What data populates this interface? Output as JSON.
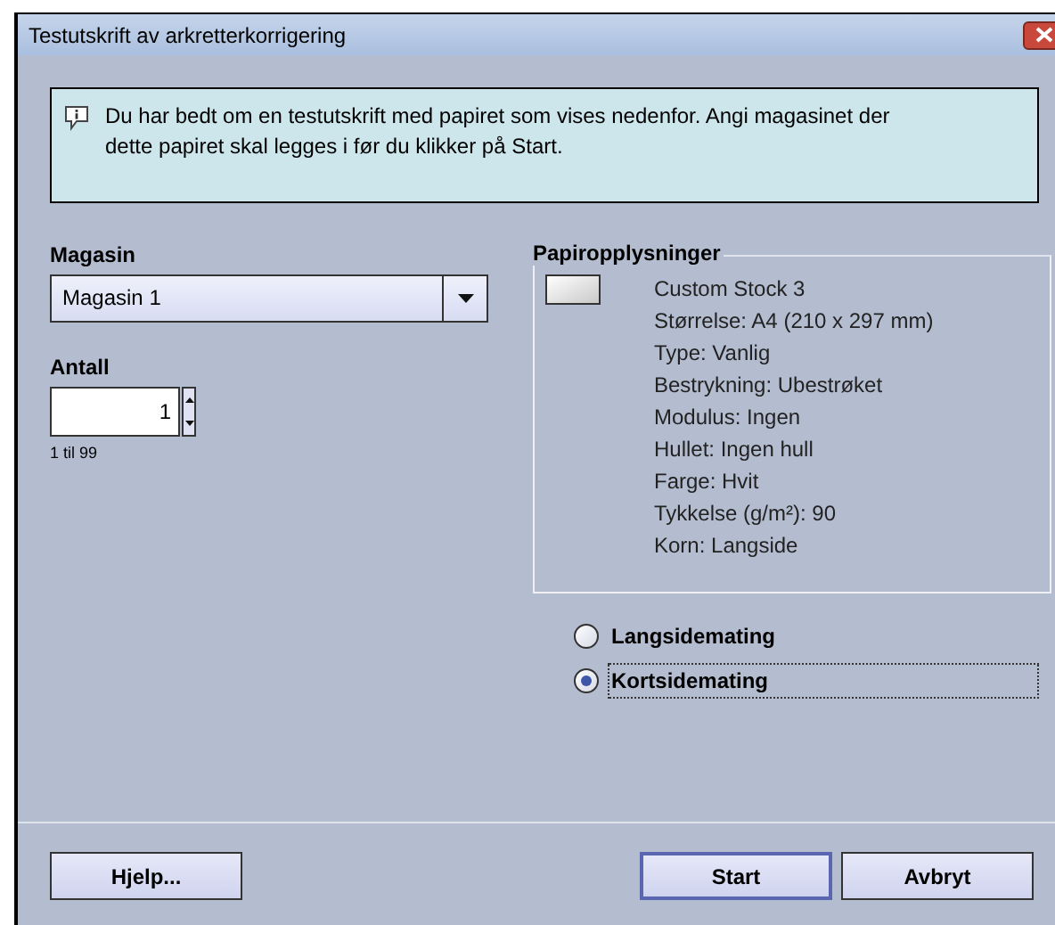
{
  "window": {
    "title": "Testutskrift av arkretterkorrigering"
  },
  "message": "Du har bedt om en testutskrift med papiret som vises nedenfor.  Angi magasinet der dette papiret skal legges i før du klikker på Start.",
  "tray": {
    "label": "Magasin",
    "value": "Magasin 1"
  },
  "quantity": {
    "label": "Antall",
    "value": "1",
    "range": "1 til 99"
  },
  "paper_info": {
    "title": "Papiropplysninger",
    "lines": [
      "Custom Stock 3",
      "Størrelse: A4 (210 x 297 mm)",
      "Type: Vanlig",
      "Bestrykning: Ubestrøket",
      "Modulus: Ingen",
      "Hullet: Ingen hull",
      "Farge: Hvit",
      "Tykkelse (g/m²): 90",
      "Korn: Langside"
    ]
  },
  "feed_options": [
    {
      "label": "Langsidemating",
      "selected": false
    },
    {
      "label": "Kortsidemating",
      "selected": true
    }
  ],
  "buttons": [
    {
      "label": "Hjelp...",
      "kind": "left"
    },
    {
      "label": "Start",
      "kind": "default"
    },
    {
      "label": "Avbryt",
      "kind": "right"
    }
  ]
}
